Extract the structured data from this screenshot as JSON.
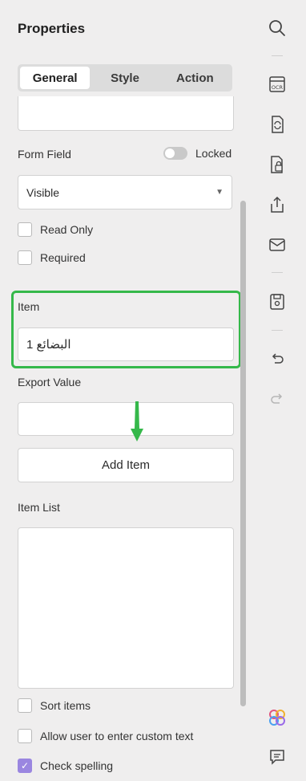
{
  "panel": {
    "title": "Properties",
    "tabs": [
      "General",
      "Style",
      "Action"
    ],
    "active_tab": "General",
    "form_field_label": "Form Field",
    "locked_label": "Locked",
    "locked_on": false,
    "visibility": {
      "selected": "Visible"
    },
    "checks": {
      "read_only": {
        "label": "Read Only",
        "checked": false
      },
      "required": {
        "label": "Required",
        "checked": false
      }
    },
    "item_label": "Item",
    "item_value": "البضائع 1",
    "export_value_label": "Export Value",
    "export_value": "",
    "add_item_label": "Add Item",
    "item_list_label": "Item List",
    "bottom_checks": {
      "sort_items": {
        "label": "Sort items",
        "checked": false
      },
      "allow_custom": {
        "label": "Allow user to enter custom text",
        "checked": false
      },
      "check_spelling": {
        "label": "Check spelling",
        "checked": true
      }
    }
  },
  "toolbar": {
    "icons": [
      "search-icon",
      "ocr-icon",
      "convert-icon",
      "protect-icon",
      "share-icon",
      "mail-icon",
      "save-icon",
      "undo-icon",
      "redo-icon",
      "ai-assistant-icon",
      "comment-icon"
    ]
  },
  "colors": {
    "highlight": "#35b84a",
    "accent_check": "#9a86e0",
    "background": "#efeeee"
  }
}
